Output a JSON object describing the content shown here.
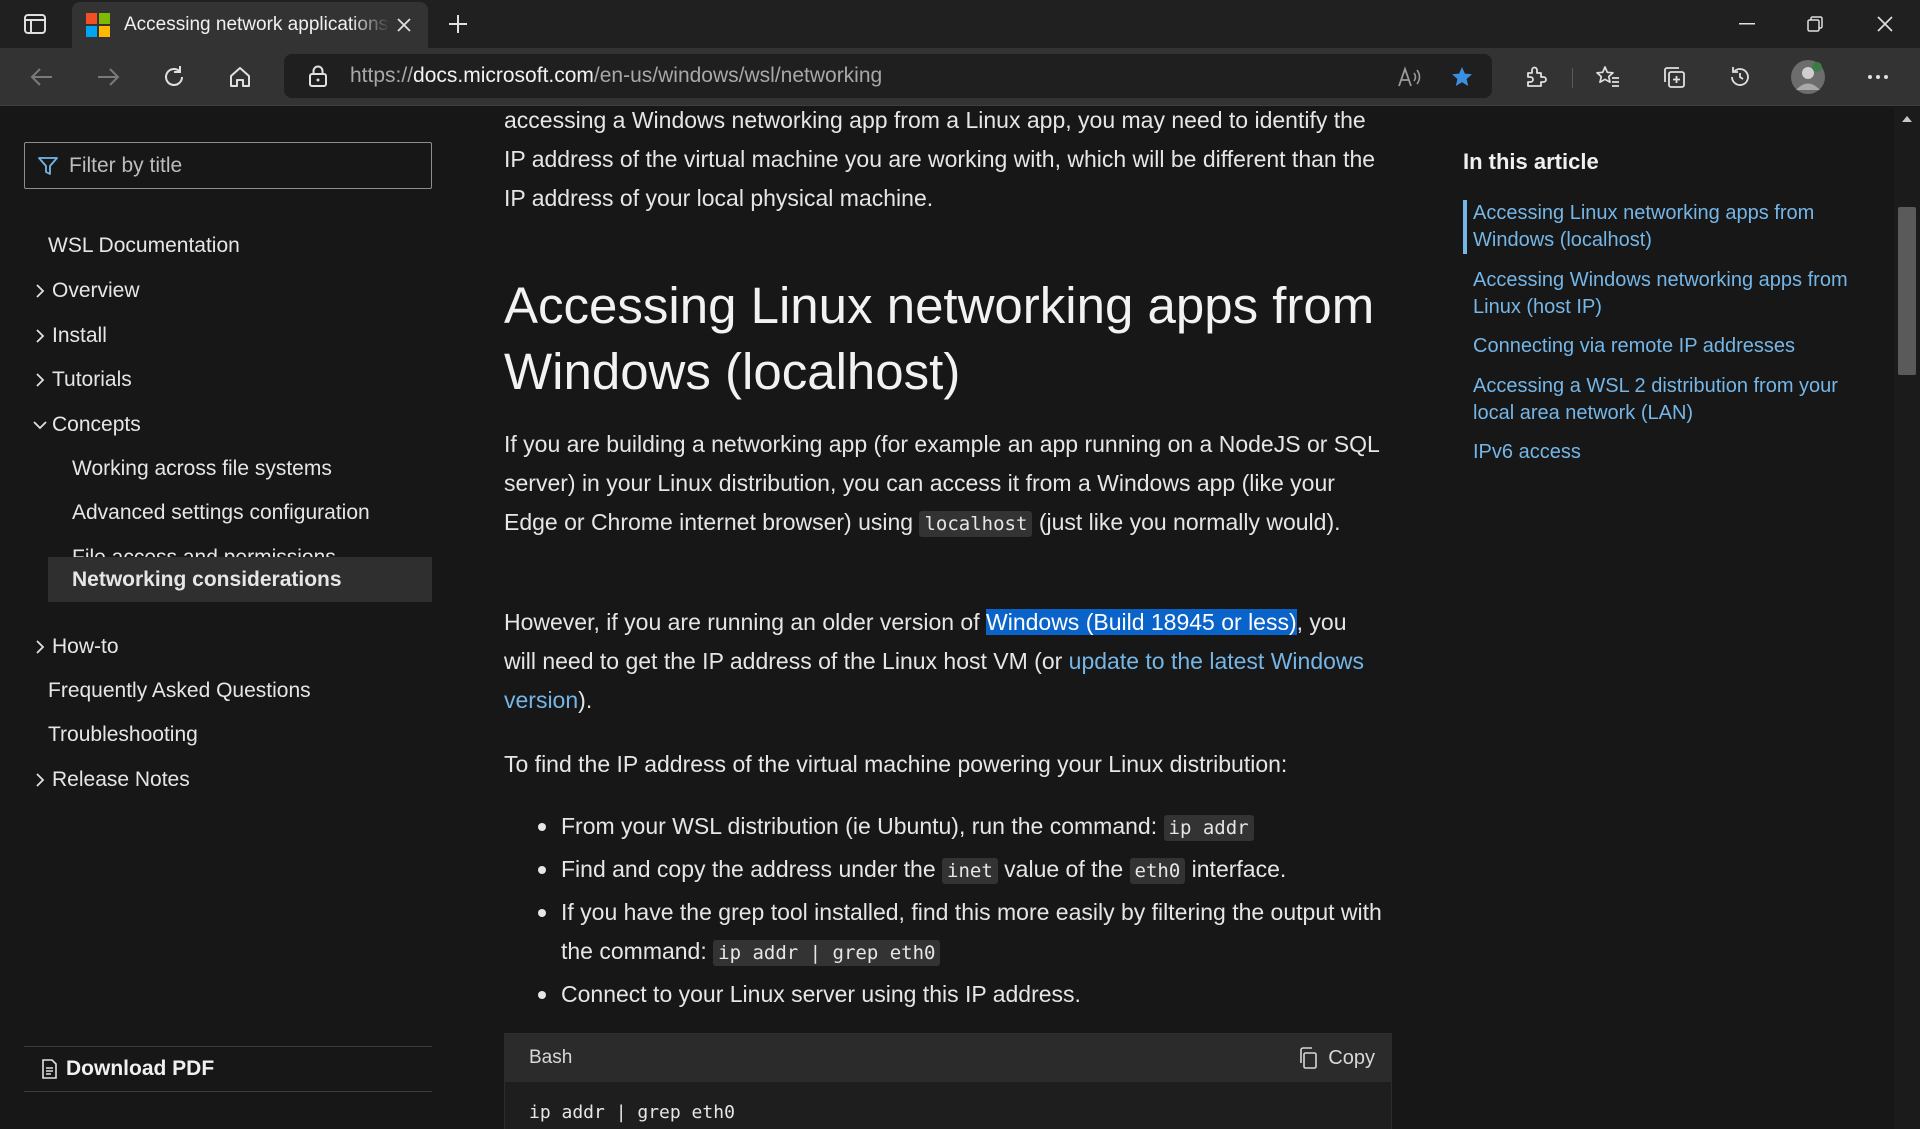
{
  "browser": {
    "tab_title": "Accessing network applications with WSL",
    "url_prefix": "https://",
    "url_host": "docs.microsoft.com",
    "url_path": "/en-us/windows/wsl/networking"
  },
  "left_nav": {
    "filter_placeholder": "Filter by title",
    "items": [
      {
        "label": "WSL Documentation"
      },
      {
        "label": "Overview"
      },
      {
        "label": "Install"
      },
      {
        "label": "Tutorials"
      },
      {
        "label": "Concepts"
      },
      {
        "label": "Working across file systems"
      },
      {
        "label": "Advanced settings configuration"
      },
      {
        "label": "File access and permissions"
      },
      {
        "label": "Networking considerations"
      },
      {
        "label": "How-to"
      },
      {
        "label": "Frequently Asked Questions"
      },
      {
        "label": "Troubleshooting"
      },
      {
        "label": "Release Notes"
      }
    ],
    "download_pdf": "Download PDF"
  },
  "article": {
    "intro": "accessing a Windows networking app from a Linux app, you may need to identify the IP address of the virtual machine you are working with, which will be different than the IP address of your local physical machine.",
    "heading": "Accessing Linux networking apps from Windows (localhost)",
    "p1_a": "If you are building a networking app (for example an app running on a NodeJS or SQL server) in your Linux distribution, you can access it from a Windows app (like your Edge or Chrome internet browser) using ",
    "p1_code": "localhost",
    "p1_b": " (just like you normally would).",
    "p2_a": "However, if you are running an older version of ",
    "p2_sel": "Windows (Build 18945 or less)",
    "p2_b": ", you will need to get the IP address of the Linux host VM (or ",
    "p2_link": "update to the latest Windows version",
    "p2_c": ").",
    "p3": "To find the IP address of the virtual machine powering your Linux distribution:",
    "b1_a": "From your WSL distribution (ie Ubuntu), run the command: ",
    "b1_code": "ip addr",
    "b2_a": "Find and copy the address under the ",
    "b2_code1": "inet",
    "b2_b": " value of the ",
    "b2_code2": "eth0",
    "b2_c": " interface.",
    "b3_a": "If you have the grep tool installed, find this more easily by filtering the output with the command: ",
    "b3_code": "ip addr | grep eth0",
    "b4": "Connect to your Linux server using this IP address.",
    "code_lang": "Bash",
    "code_copy": "Copy",
    "code_text": "ip addr | grep eth0"
  },
  "toc": {
    "title": "In this article",
    "links": [
      "Accessing Linux networking apps from Windows (localhost)",
      "Accessing Windows networking apps from Linux (host IP)",
      "Connecting via remote IP addresses",
      "Accessing a WSL 2 distribution from your local area network (LAN)",
      "IPv6 access"
    ]
  },
  "colors": {
    "accent_link": "#75b6e7",
    "selection": "#0a63c9",
    "favorite_star": "#3b8fe0"
  }
}
